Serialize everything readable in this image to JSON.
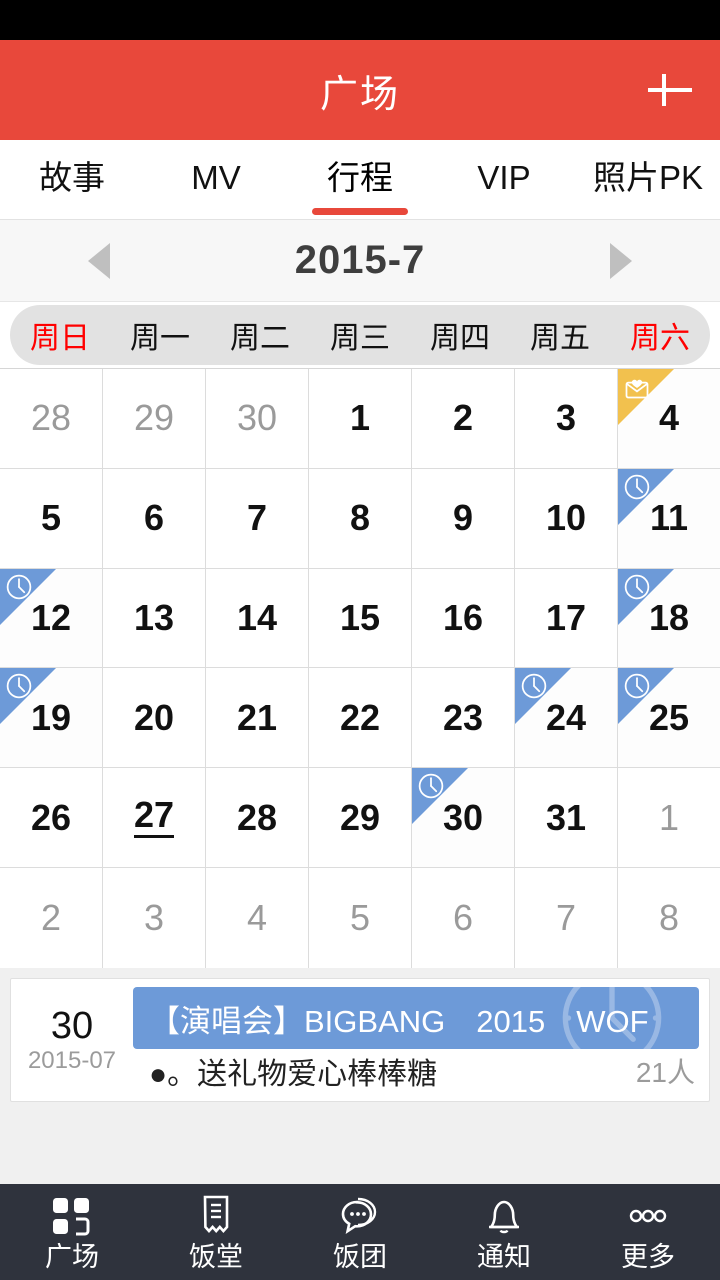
{
  "colors": {
    "header_red": "#e8483b",
    "accent_red": "#e8483b",
    "weekend_red": "#ff0000",
    "marker_blue": "#6d9ad8",
    "marker_yellow": "#f2c14e",
    "bottom_nav": "#2f333d",
    "page_bg": "#f0f0f0"
  },
  "header": {
    "title": "广场",
    "add_icon": "plus-icon"
  },
  "tabs": [
    {
      "label": "故事",
      "active": false
    },
    {
      "label": "MV",
      "active": false
    },
    {
      "label": "行程",
      "active": true
    },
    {
      "label": "VIP",
      "active": false
    },
    {
      "label": "照片PK",
      "active": false
    }
  ],
  "month_nav": {
    "prev_icon": "chevron-left-icon",
    "next_icon": "chevron-right-icon",
    "label": "2015-7"
  },
  "weekdays": [
    {
      "label": "周日",
      "weekend": true
    },
    {
      "label": "周一",
      "weekend": false
    },
    {
      "label": "周二",
      "weekend": false
    },
    {
      "label": "周三",
      "weekend": false
    },
    {
      "label": "周四",
      "weekend": false
    },
    {
      "label": "周五",
      "weekend": false
    },
    {
      "label": "周六",
      "weekend": true
    }
  ],
  "calendar": {
    "rows": [
      [
        {
          "day": "28",
          "out": true,
          "marker": null,
          "today": false
        },
        {
          "day": "29",
          "out": true,
          "marker": null,
          "today": false
        },
        {
          "day": "30",
          "out": true,
          "marker": null,
          "today": false
        },
        {
          "day": "1",
          "out": false,
          "marker": null,
          "today": false
        },
        {
          "day": "2",
          "out": false,
          "marker": null,
          "today": false
        },
        {
          "day": "3",
          "out": false,
          "marker": null,
          "today": false
        },
        {
          "day": "4",
          "out": false,
          "marker": "mail",
          "today": false
        }
      ],
      [
        {
          "day": "5",
          "out": false,
          "marker": null,
          "today": false
        },
        {
          "day": "6",
          "out": false,
          "marker": null,
          "today": false
        },
        {
          "day": "7",
          "out": false,
          "marker": null,
          "today": false
        },
        {
          "day": "8",
          "out": false,
          "marker": null,
          "today": false
        },
        {
          "day": "9",
          "out": false,
          "marker": null,
          "today": false
        },
        {
          "day": "10",
          "out": false,
          "marker": null,
          "today": false
        },
        {
          "day": "11",
          "out": false,
          "marker": "clock",
          "today": false
        }
      ],
      [
        {
          "day": "12",
          "out": false,
          "marker": "clock",
          "today": false
        },
        {
          "day": "13",
          "out": false,
          "marker": null,
          "today": false
        },
        {
          "day": "14",
          "out": false,
          "marker": null,
          "today": false
        },
        {
          "day": "15",
          "out": false,
          "marker": null,
          "today": false
        },
        {
          "day": "16",
          "out": false,
          "marker": null,
          "today": false
        },
        {
          "day": "17",
          "out": false,
          "marker": null,
          "today": false
        },
        {
          "day": "18",
          "out": false,
          "marker": "clock",
          "today": false
        }
      ],
      [
        {
          "day": "19",
          "out": false,
          "marker": "clock",
          "today": false
        },
        {
          "day": "20",
          "out": false,
          "marker": null,
          "today": false
        },
        {
          "day": "21",
          "out": false,
          "marker": null,
          "today": false
        },
        {
          "day": "22",
          "out": false,
          "marker": null,
          "today": false
        },
        {
          "day": "23",
          "out": false,
          "marker": null,
          "today": false
        },
        {
          "day": "24",
          "out": false,
          "marker": "clock",
          "today": false
        },
        {
          "day": "25",
          "out": false,
          "marker": "clock",
          "today": false
        }
      ],
      [
        {
          "day": "26",
          "out": false,
          "marker": null,
          "today": false
        },
        {
          "day": "27",
          "out": false,
          "marker": null,
          "today": true
        },
        {
          "day": "28",
          "out": false,
          "marker": null,
          "today": false
        },
        {
          "day": "29",
          "out": false,
          "marker": null,
          "today": false
        },
        {
          "day": "30",
          "out": false,
          "marker": "clock",
          "today": false
        },
        {
          "day": "31",
          "out": false,
          "marker": null,
          "today": false
        },
        {
          "day": "1",
          "out": true,
          "marker": null,
          "today": false
        }
      ],
      [
        {
          "day": "2",
          "out": true,
          "marker": null,
          "today": false
        },
        {
          "day": "3",
          "out": true,
          "marker": null,
          "today": false
        },
        {
          "day": "4",
          "out": true,
          "marker": null,
          "today": false
        },
        {
          "day": "5",
          "out": true,
          "marker": null,
          "today": false
        },
        {
          "day": "6",
          "out": true,
          "marker": null,
          "today": false
        },
        {
          "day": "7",
          "out": true,
          "marker": null,
          "today": false
        },
        {
          "day": "8",
          "out": true,
          "marker": null,
          "today": false
        }
      ]
    ]
  },
  "event": {
    "day": "30",
    "year_month": "2015-07",
    "banner_title": "【演唱会】BIGBANG　2015　WOF",
    "banner_icon": "clock-icon",
    "sub_text": "●。送礼物爱心棒棒糖",
    "count": "21人"
  },
  "bottom_nav": [
    {
      "label": "广场",
      "icon": "grid-icon",
      "active": true
    },
    {
      "label": "饭堂",
      "icon": "receipt-icon",
      "active": false
    },
    {
      "label": "饭团",
      "icon": "chat-icon",
      "active": false
    },
    {
      "label": "通知",
      "icon": "bell-icon",
      "active": false
    },
    {
      "label": "更多",
      "icon": "more-icon",
      "active": false
    }
  ]
}
